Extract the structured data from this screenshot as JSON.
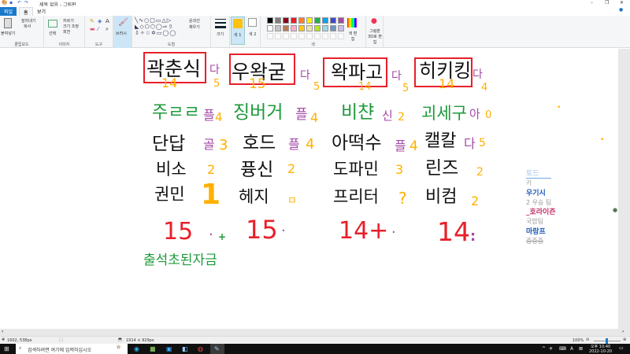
{
  "window": {
    "title": "제목 없음 - 그림판",
    "controls": [
      "–",
      "❐",
      "✕"
    ]
  },
  "tabs": [
    "파일",
    "홈",
    "보기"
  ],
  "ribbon": {
    "clipboard": {
      "paste": "붙여넣기",
      "cut": "잘라내기",
      "copy": "복사",
      "label": "클립보드"
    },
    "image": {
      "select": "선택",
      "crop": "자르기",
      "resize": "크기 조정",
      "rotate": "회전",
      "label": "이미지"
    },
    "tools": {
      "label": "도구"
    },
    "brush": {
      "label": "브러시"
    },
    "shapes": {
      "outline": "윤곽선",
      "fill": "채우기",
      "label": "도형"
    },
    "size": {
      "label": "크기"
    },
    "color1": {
      "label": "색 1"
    },
    "color2": {
      "label": "색 2"
    },
    "colors": {
      "label": "색",
      "palette": [
        "#000000",
        "#7f7f7f",
        "#880015",
        "#ed1c24",
        "#ff7f27",
        "#fff200",
        "#22b14c",
        "#00a2e8",
        "#3f48cc",
        "#a349a4",
        "#ffffff",
        "#c3c3c3",
        "#b97a57",
        "#ffaec9",
        "#ffc90e",
        "#efe4b0",
        "#b5e61d",
        "#99d9ea",
        "#7092be",
        "#c8bfe7"
      ],
      "selected": "#ffc20e"
    },
    "edit_colors": "색 편집",
    "paint3d": "그림판 3D로 편집"
  },
  "canvas": {
    "columns": [
      {
        "team": "곽춘식",
        "team_score": "14",
        "side": "다",
        "side_num": "5",
        "players": [
          {
            "name": "주ㄹㄹ",
            "tag": "플",
            "num": "4"
          },
          {
            "name": "단답",
            "tag": "골",
            "num": "3"
          },
          {
            "name": "비소",
            "tag": "",
            "num": "2"
          },
          {
            "name": "권민",
            "tag": "",
            "num": "1"
          }
        ],
        "total": "15",
        "marks": "·",
        "mark2": "+"
      },
      {
        "team": "우왁굳",
        "team_score": "15",
        "side": "다",
        "side_num": "5",
        "players": [
          {
            "name": "징버거",
            "tag": "플",
            "num": "4"
          },
          {
            "name": "호드",
            "tag": "플",
            "num": "4"
          },
          {
            "name": "퓽신",
            "tag": "",
            "num": "2"
          },
          {
            "name": "헤지",
            "tag": "",
            "num": "ㅁ"
          }
        ],
        "total": "15",
        "marks": "·",
        "mark2": ""
      },
      {
        "team": "왁파고",
        "team_score": "14",
        "side": "다",
        "side_num": "5",
        "players": [
          {
            "name": "비챤",
            "tag": "신",
            "num": "2"
          },
          {
            "name": "아떡수",
            "tag": "플",
            "num": "4"
          },
          {
            "name": "도파민",
            "tag": "",
            "num": "3"
          },
          {
            "name": "프리터",
            "tag": "",
            "num": "?"
          }
        ],
        "total": "14+",
        "marks": "·",
        "mark2": ""
      },
      {
        "team": "히키킹",
        "team_score": "14",
        "side": "다",
        "side_num": "4",
        "players": [
          {
            "name": "괴세구",
            "tag": "아",
            "num": "0"
          },
          {
            "name": "캘칼",
            "tag": "다",
            "num": "5"
          },
          {
            "name": "린즈",
            "tag": "",
            "num": "2"
          },
          {
            "name": "비컴",
            "tag": "",
            "num": "2"
          }
        ],
        "total": "14",
        "marks": ":",
        "mark2": ""
      }
    ],
    "note": "출석초된자금"
  },
  "right_panel": [
    {
      "name": "토드",
      "sub": "카"
    },
    {
      "name": "우기시",
      "sub": "2 우승 팀"
    },
    {
      "name": "_호라이즌",
      "sub": "국밥팀"
    },
    {
      "name": "마랑프",
      "sub": "중중중"
    }
  ],
  "status": {
    "cursor": "1602, 538px",
    "canvas_size": "1914 × 929px",
    "zoom": "100%"
  },
  "taskbar": {
    "search_placeholder": "검색하려면 여기에 입력하십시오",
    "time": "오후 10:40",
    "date": "2022-10-20"
  }
}
